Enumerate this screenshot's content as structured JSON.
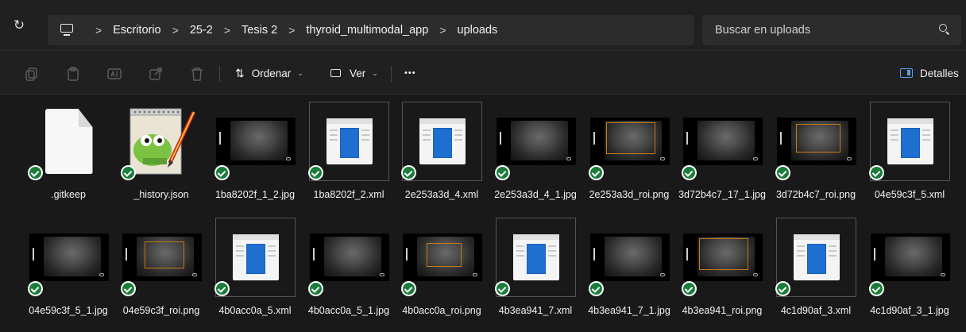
{
  "address": {
    "breadcrumbs": [
      "Escritorio",
      "25-2",
      "Tesis 2",
      "thyroid_multimodal_app",
      "uploads"
    ],
    "separator": ">",
    "refresh_icon": "refresh-icon",
    "pc_icon": "this-pc-icon"
  },
  "search": {
    "placeholder": "Buscar en uploads",
    "icon": "search-icon"
  },
  "toolbar": {
    "sort_label": "Ordenar",
    "view_label": "Ver",
    "more_label": "•••",
    "details_label": "Detalles",
    "disabled_icons": [
      "copy-icon",
      "paste-icon",
      "rename-icon",
      "share-icon",
      "delete-icon"
    ]
  },
  "files": [
    {
      "name": ".gitkeep",
      "kind": "blank"
    },
    {
      "name": "_history.json",
      "kind": "notepad"
    },
    {
      "name": "1ba8202f_1_2.jpg",
      "kind": "us"
    },
    {
      "name": "1ba8202f_2.xml",
      "kind": "xml"
    },
    {
      "name": "2e253a3d_4.xml",
      "kind": "xml"
    },
    {
      "name": "2e253a3d_4_1.jpg",
      "kind": "us"
    },
    {
      "name": "2e253a3d_roi.png",
      "kind": "us-roi"
    },
    {
      "name": "3d72b4c7_17_1.jpg",
      "kind": "us"
    },
    {
      "name": "3d72b4c7_roi.png",
      "kind": "us-roi"
    },
    {
      "name": "04e59c3f_5.xml",
      "kind": "xml"
    },
    {
      "name": "04e59c3f_5_1.jpg",
      "kind": "us"
    },
    {
      "name": "04e59c3f_roi.png",
      "kind": "us-roi"
    },
    {
      "name": "4b0acc0a_5.xml",
      "kind": "xml"
    },
    {
      "name": "4b0acc0a_5_1.jpg",
      "kind": "us"
    },
    {
      "name": "4b0acc0a_roi.png",
      "kind": "us-roi"
    },
    {
      "name": "4b3ea941_7.xml",
      "kind": "xml"
    },
    {
      "name": "4b3ea941_7_1.jpg",
      "kind": "us"
    },
    {
      "name": "4b3ea941_roi.png",
      "kind": "us-roi"
    },
    {
      "name": "4c1d90af_3.xml",
      "kind": "xml"
    },
    {
      "name": "4c1d90af_3_1.jpg",
      "kind": "us"
    }
  ],
  "status_icon": "synced-check-icon",
  "colors": {
    "background": "#191919",
    "bar": "#202020",
    "check": "#1a7d3a",
    "roi": "#c87a18",
    "xml_blue": "#1f6fd1"
  }
}
